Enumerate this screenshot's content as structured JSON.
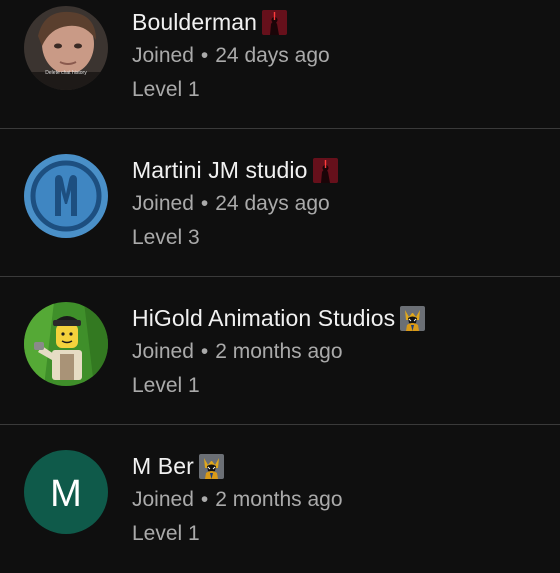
{
  "members": [
    {
      "name": "Boulderman",
      "joined_prefix": "Joined",
      "separator": "•",
      "joined_ago": "24 days ago",
      "level": "Level 1",
      "badge_icon": "red-dark-figure-badge-icon",
      "avatar_icon": "face-photo-avatar",
      "avatar_caption": "Delete chat history"
    },
    {
      "name": "Martini JM studio",
      "joined_prefix": "Joined",
      "separator": "•",
      "joined_ago": "24 days ago",
      "level": "Level 3",
      "badge_icon": "red-dark-figure-badge-icon",
      "avatar_icon": "blue-m-logo-avatar"
    },
    {
      "name": "HiGold Animation Studios",
      "joined_prefix": "Joined",
      "separator": "•",
      "joined_ago": "2 months ago",
      "level": "Level 1",
      "badge_icon": "wolverine-badge-icon",
      "avatar_icon": "lego-minifigure-avatar"
    },
    {
      "name": "M Ber",
      "joined_prefix": "Joined",
      "separator": "•",
      "joined_ago": "2 months ago",
      "level": "Level 1",
      "badge_icon": "wolverine-badge-icon",
      "avatar_icon": "letter-avatar",
      "avatar_letter": "M",
      "avatar_color": "#0f5a4a"
    }
  ],
  "colors": {
    "background": "#0f0f0f",
    "primary_text": "#f1f1f1",
    "secondary_text": "#aaaaaa",
    "divider": "#3a3a3a"
  }
}
